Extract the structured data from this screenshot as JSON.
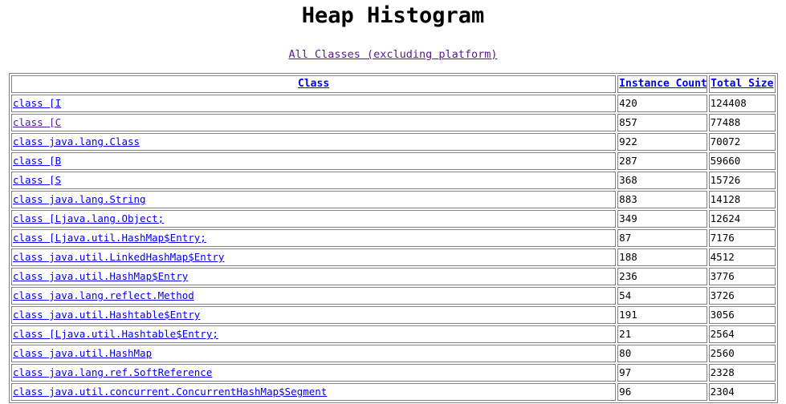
{
  "page": {
    "title": "Heap Histogram",
    "all_classes_link": "All Classes (excluding platform)"
  },
  "table": {
    "headers": {
      "class": "Class",
      "instance_count": "Instance Count",
      "total_size": "Total Size"
    },
    "rows": [
      {
        "class": "class [I",
        "count": "420",
        "size": "124408",
        "visited": false
      },
      {
        "class": "class [C",
        "count": "857",
        "size": "77488",
        "visited": true
      },
      {
        "class": "class java.lang.Class",
        "count": "922",
        "size": "70072",
        "visited": false
      },
      {
        "class": "class [B",
        "count": "287",
        "size": "59660",
        "visited": false
      },
      {
        "class": "class [S",
        "count": "368",
        "size": "15726",
        "visited": false
      },
      {
        "class": "class java.lang.String",
        "count": "883",
        "size": "14128",
        "visited": false
      },
      {
        "class": "class [Ljava.lang.Object;",
        "count": "349",
        "size": "12624",
        "visited": false
      },
      {
        "class": "class [Ljava.util.HashMap$Entry;",
        "count": "87",
        "size": "7176",
        "visited": false
      },
      {
        "class": "class java.util.LinkedHashMap$Entry",
        "count": "188",
        "size": "4512",
        "visited": false
      },
      {
        "class": "class java.util.HashMap$Entry",
        "count": "236",
        "size": "3776",
        "visited": false
      },
      {
        "class": "class java.lang.reflect.Method",
        "count": "54",
        "size": "3726",
        "visited": false
      },
      {
        "class": "class java.util.Hashtable$Entry",
        "count": "191",
        "size": "3056",
        "visited": false
      },
      {
        "class": "class [Ljava.util.Hashtable$Entry;",
        "count": "21",
        "size": "2564",
        "visited": false
      },
      {
        "class": "class java.util.HashMap",
        "count": "80",
        "size": "2560",
        "visited": false
      },
      {
        "class": "class java.lang.ref.SoftReference",
        "count": "97",
        "size": "2328",
        "visited": false
      },
      {
        "class": "class java.util.concurrent.ConcurrentHashMap$Segment",
        "count": "96",
        "size": "2304",
        "visited": false
      }
    ]
  },
  "colors": {
    "link": "#0000ee",
    "visited_link": "#551a8b",
    "border": "#808080"
  }
}
